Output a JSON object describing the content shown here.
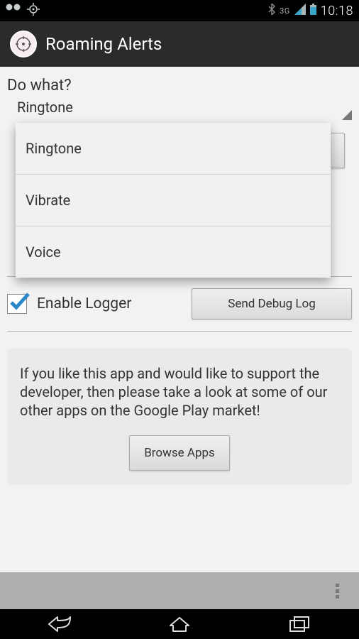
{
  "status": {
    "time": "10:18",
    "network_label": "3G"
  },
  "app": {
    "title": "Roaming Alerts"
  },
  "section": {
    "title": "Do what?"
  },
  "spinner": {
    "selected": "Ringtone",
    "options": [
      "Ringtone",
      "Vibrate",
      "Voice"
    ]
  },
  "logger": {
    "label": "Enable Logger",
    "checked": true,
    "button": "Send Debug Log"
  },
  "promo": {
    "text": "If you like this app and would like to support the developer, then please take a look at some of our other apps on the Google Play market!",
    "button": "Browse Apps"
  }
}
